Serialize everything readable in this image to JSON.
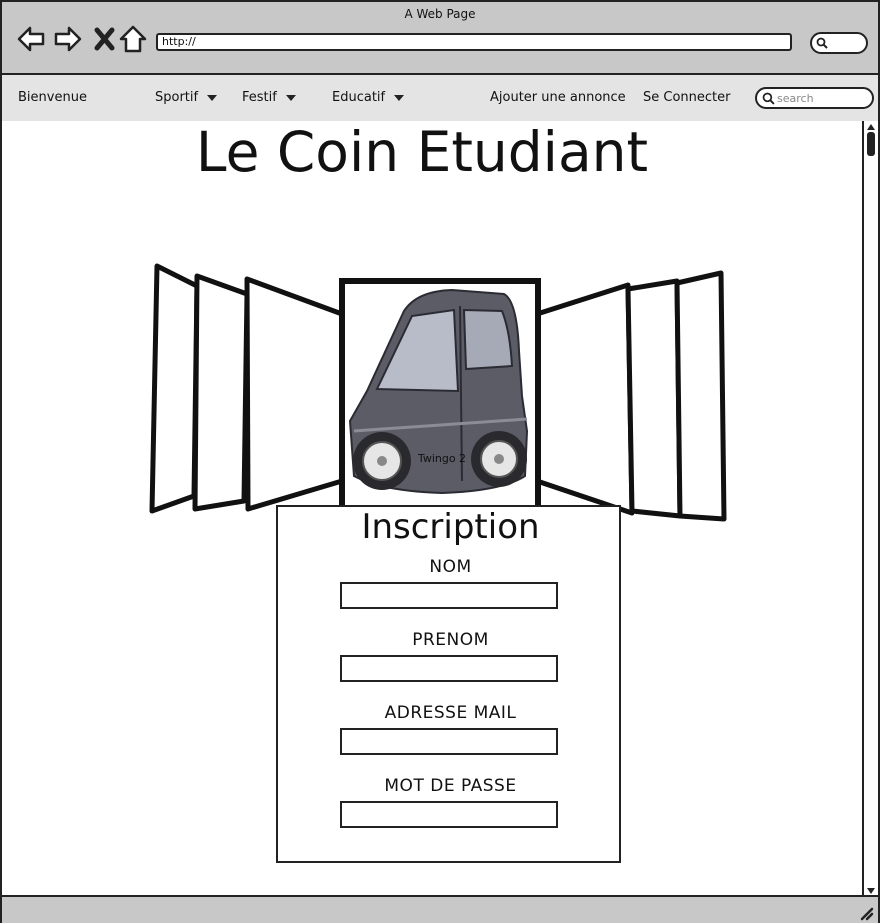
{
  "window": {
    "title": "A Web Page",
    "url": "http://"
  },
  "menu": {
    "items": [
      {
        "label": "Bienvenue"
      },
      {
        "label": "Sportif"
      },
      {
        "label": "Festif"
      },
      {
        "label": "Educatif"
      },
      {
        "label": "Ajouter une annonce"
      },
      {
        "label": "Se Connecter"
      }
    ],
    "search_placeholder": "search"
  },
  "page": {
    "title": "Le Coin Etudiant",
    "carousel_caption": "Twingo 2"
  },
  "form": {
    "title": "Inscription",
    "fields": [
      {
        "label": "NOM",
        "value": ""
      },
      {
        "label": "PRENOM",
        "value": ""
      },
      {
        "label": "ADRESSE MAIL",
        "value": ""
      },
      {
        "label": "MOT DE PASSE",
        "value": ""
      }
    ]
  }
}
